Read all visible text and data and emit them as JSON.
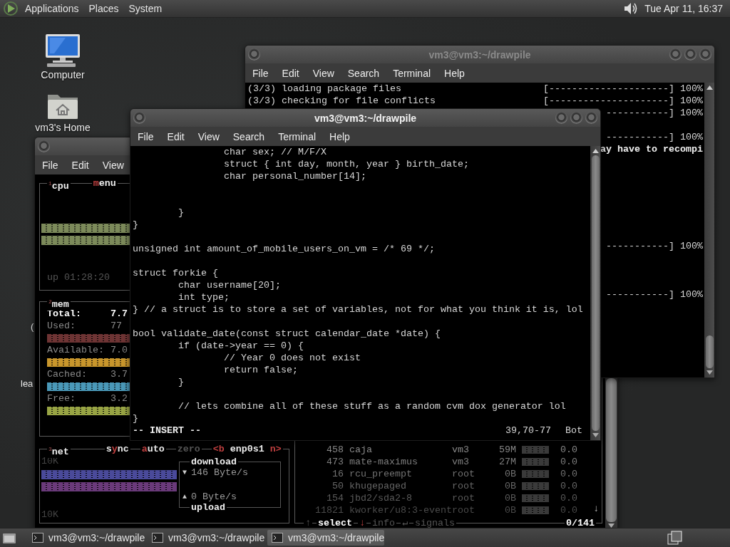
{
  "top_panel": {
    "menus": [
      "Applications",
      "Places",
      "System"
    ],
    "clock": "Tue Apr 11, 16:37"
  },
  "desktop_icons": [
    {
      "kind": "computer",
      "label": "Computer"
    },
    {
      "kind": "home",
      "label": "vm3's Home"
    }
  ],
  "covered_icon_labels": [
    "(",
    "lea"
  ],
  "btop_window": {
    "menu": [
      "File",
      "Edit",
      "View"
    ],
    "cpu_box": {
      "title": "$^{1}$cpu",
      "tabs": [
        {
          "parts": [
            {
              "text": "m",
              "kind": "hot"
            },
            {
              "text": "enu",
              "kind": "plain"
            }
          ]
        }
      ],
      "uptime": "up 01:28:20"
    },
    "mem_box": {
      "title": "$^{2}$mem",
      "rows": [
        {
          "kind": "total",
          "label": "Total:",
          "value": "7.7"
        },
        {
          "kind": "meter",
          "label": "Used:",
          "value": "77",
          "color": "#6e3434"
        },
        {
          "kind": "meter",
          "label": "Available:",
          "value": "7.0",
          "color": "#c8962c"
        },
        {
          "kind": "meter",
          "label": "Cached:",
          "value": "3.7",
          "color": "#4a98b8"
        },
        {
          "kind": "meter",
          "label": "Free:",
          "value": "3.2",
          "color": "#98a444"
        }
      ]
    },
    "net_box": {
      "title": "$^{3}$net",
      "tabs": [
        {
          "parts": [
            {
              "text": "s",
              "kind": "plain"
            },
            {
              "text": "y",
              "kind": "hot"
            },
            {
              "text": "nc",
              "kind": "plain"
            }
          ]
        },
        {
          "parts": [
            {
              "text": "a",
              "kind": "hot"
            },
            {
              "text": "uto",
              "kind": "plain"
            }
          ]
        },
        {
          "parts": [
            {
              "text": "z",
              "kind": "dim"
            },
            {
              "text": "ero",
              "kind": "dim"
            }
          ]
        },
        {
          "parts": [
            {
              "text": "<b",
              "kind": "hot"
            },
            {
              "text": " enp0s1 ",
              "kind": "plain"
            },
            {
              "text": "n>",
              "kind": "hot"
            }
          ]
        }
      ],
      "scale_top": "10K",
      "scale_bottom": "10K",
      "graphs": [
        {
          "color": "#4a4a9a"
        },
        {
          "color": "#6a3a7a"
        }
      ],
      "download": {
        "label": "download",
        "arrow": "▼",
        "rate": "146 Byte/s"
      },
      "upload": {
        "label": "upload",
        "arrow": "▲",
        "rate": "0 Byte/s"
      }
    },
    "processes": {
      "rows": [
        {
          "pid": "458",
          "name": "caja",
          "user": "vm3",
          "mem": "59M",
          "cpu": "0.0"
        },
        {
          "pid": "473",
          "name": "mate-maximus",
          "user": "vm3",
          "mem": "27M",
          "cpu": "0.0"
        },
        {
          "pid": "16",
          "name": "rcu_preempt",
          "user": "root",
          "mem": "0B",
          "cpu": "0.0"
        },
        {
          "pid": "50",
          "name": "khugepaged",
          "user": "root",
          "mem": "0B",
          "cpu": "0.0"
        },
        {
          "pid": "154",
          "name": "jbd2/sda2-8",
          "user": "root",
          "mem": "0B",
          "cpu": "0.0"
        },
        {
          "pid": "11821",
          "name": "kworker/u8:3-event",
          "user": "root",
          "mem": "0B",
          "cpu": "0.0"
        }
      ],
      "scroll_hint": "↓",
      "footer": [
        {
          "text": "↑",
          "kind": "dim"
        },
        {
          "text": "select",
          "kind": "bold"
        },
        {
          "text": "↓",
          "kind": "hot"
        },
        {
          "text": "info",
          "kind": "dim"
        },
        {
          "text": "↵",
          "kind": "dim"
        },
        {
          "text": "signals",
          "kind": "dim"
        }
      ],
      "count": "0/141"
    }
  },
  "pacman_window": {
    "title": "vm3@vm3:~/drawpile",
    "active": false,
    "menu": [
      "File",
      "Edit",
      "View",
      "Search",
      "Terminal",
      "Help"
    ],
    "lines": [
      {
        "left": "(3/3) loading package files",
        "right": "[---------------------] 100%"
      },
      {
        "left": "(3/3) checking for file conflicts",
        "right": "[---------------------] 100%"
      },
      {
        "right": "-----------] 100%"
      },
      {
        "kind": "blank"
      },
      {
        "right": "-----------] 100%"
      },
      {
        "right": "ay have to recompi",
        "bold": true
      },
      {
        "kind": "blank"
      },
      {
        "kind": "blank"
      },
      {
        "kind": "blank"
      },
      {
        "kind": "blank"
      },
      {
        "kind": "blank"
      },
      {
        "kind": "blank"
      },
      {
        "kind": "blank"
      },
      {
        "right": "-----------] 100%"
      },
      {
        "kind": "blank"
      },
      {
        "kind": "blank"
      },
      {
        "kind": "blank"
      },
      {
        "right": "-----------] 100%"
      }
    ]
  },
  "vim_window": {
    "title": "vm3@vm3:~/drawpile",
    "active": true,
    "menu": [
      "File",
      "Edit",
      "View",
      "Search",
      "Terminal",
      "Help"
    ],
    "lines": [
      {
        "text": "                char sex; // M/F/X"
      },
      {
        "text": "                struct { int day, month, year } birth_date;"
      },
      {
        "text": "                char personal_number[14];"
      },
      {
        "kind": "blank"
      },
      {
        "kind": "blank"
      },
      {
        "text": "        }"
      },
      {
        "text": "}"
      },
      {
        "kind": "blank"
      },
      {
        "text": "unsigned int amount_of_mobile_users_on_vm = /* 69 */;"
      },
      {
        "kind": "blank"
      },
      {
        "text": "struct forkie {"
      },
      {
        "text": "        char username[20];"
      },
      {
        "text": "        int type;"
      },
      {
        "text": "} // a struct is to store a set of variables, not for what you think it is, lol"
      },
      {
        "kind": "blank"
      },
      {
        "text": "bool validate_date(const struct calendar_date *date) {"
      },
      {
        "text": "        if (date->year == 0) {"
      },
      {
        "text": "                // Year 0 does not exist"
      },
      {
        "text": "                return false;"
      },
      {
        "text": "        }"
      },
      {
        "kind": "blank"
      },
      {
        "text": "        // lets combine all of these stuff as a random cvm dox generator lol"
      },
      {
        "text": "}"
      }
    ],
    "mode": "-- INSERT --",
    "position": "39,70-77",
    "scroll": "Bot"
  },
  "taskbar": {
    "tasks": [
      {
        "label": "vm3@vm3:~/drawpile",
        "selected": false
      },
      {
        "label": "vm3@vm3:~/drawpile",
        "selected": false
      },
      {
        "label": "vm3@vm3:~/drawpile",
        "selected": true
      }
    ]
  }
}
